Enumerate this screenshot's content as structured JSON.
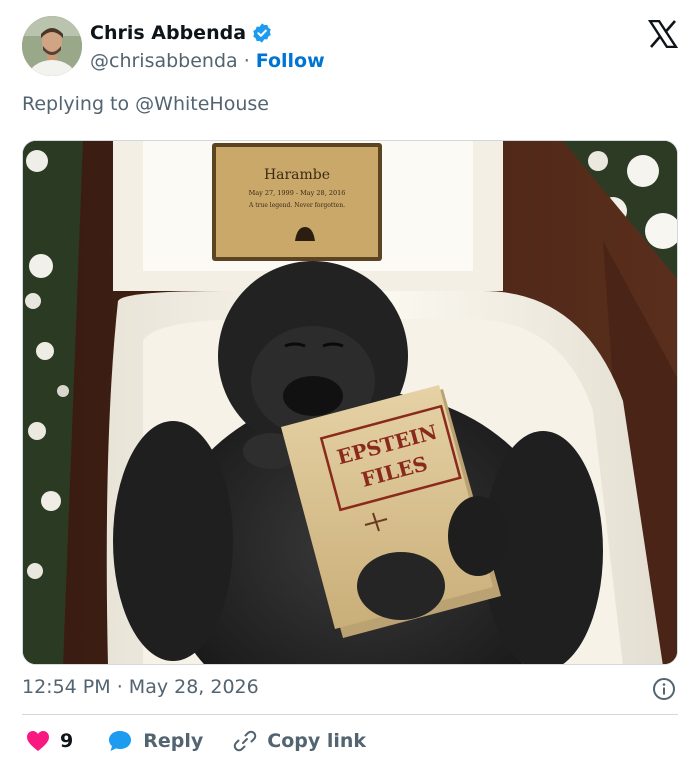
{
  "author": {
    "name": "Chris Abbenda",
    "handle": "@chrisabbenda",
    "separator": "·",
    "follow_label": "Follow",
    "verified": true
  },
  "platform_icon": "x-logo-icon",
  "replying_to": {
    "prefix": "Replying to",
    "mention": "@WhiteHouse"
  },
  "media": {
    "plaque_name": "Harambe",
    "plaque_dates": "May 27, 1999 - May 28, 2016",
    "plaque_motto": "A true legend. Never forgotten.",
    "folder_line1": "EPSTEIN",
    "folder_line2": "FILES"
  },
  "timestamp": {
    "time": "12:54 PM",
    "separator": "·",
    "date": "May 28, 2026"
  },
  "actions": {
    "like_count": "9",
    "reply_label": "Reply",
    "copy_label": "Copy link"
  },
  "colors": {
    "accent": "#0074d4",
    "like": "#f91880",
    "reply_icon": "#1d9bf0",
    "muted": "#536471"
  }
}
